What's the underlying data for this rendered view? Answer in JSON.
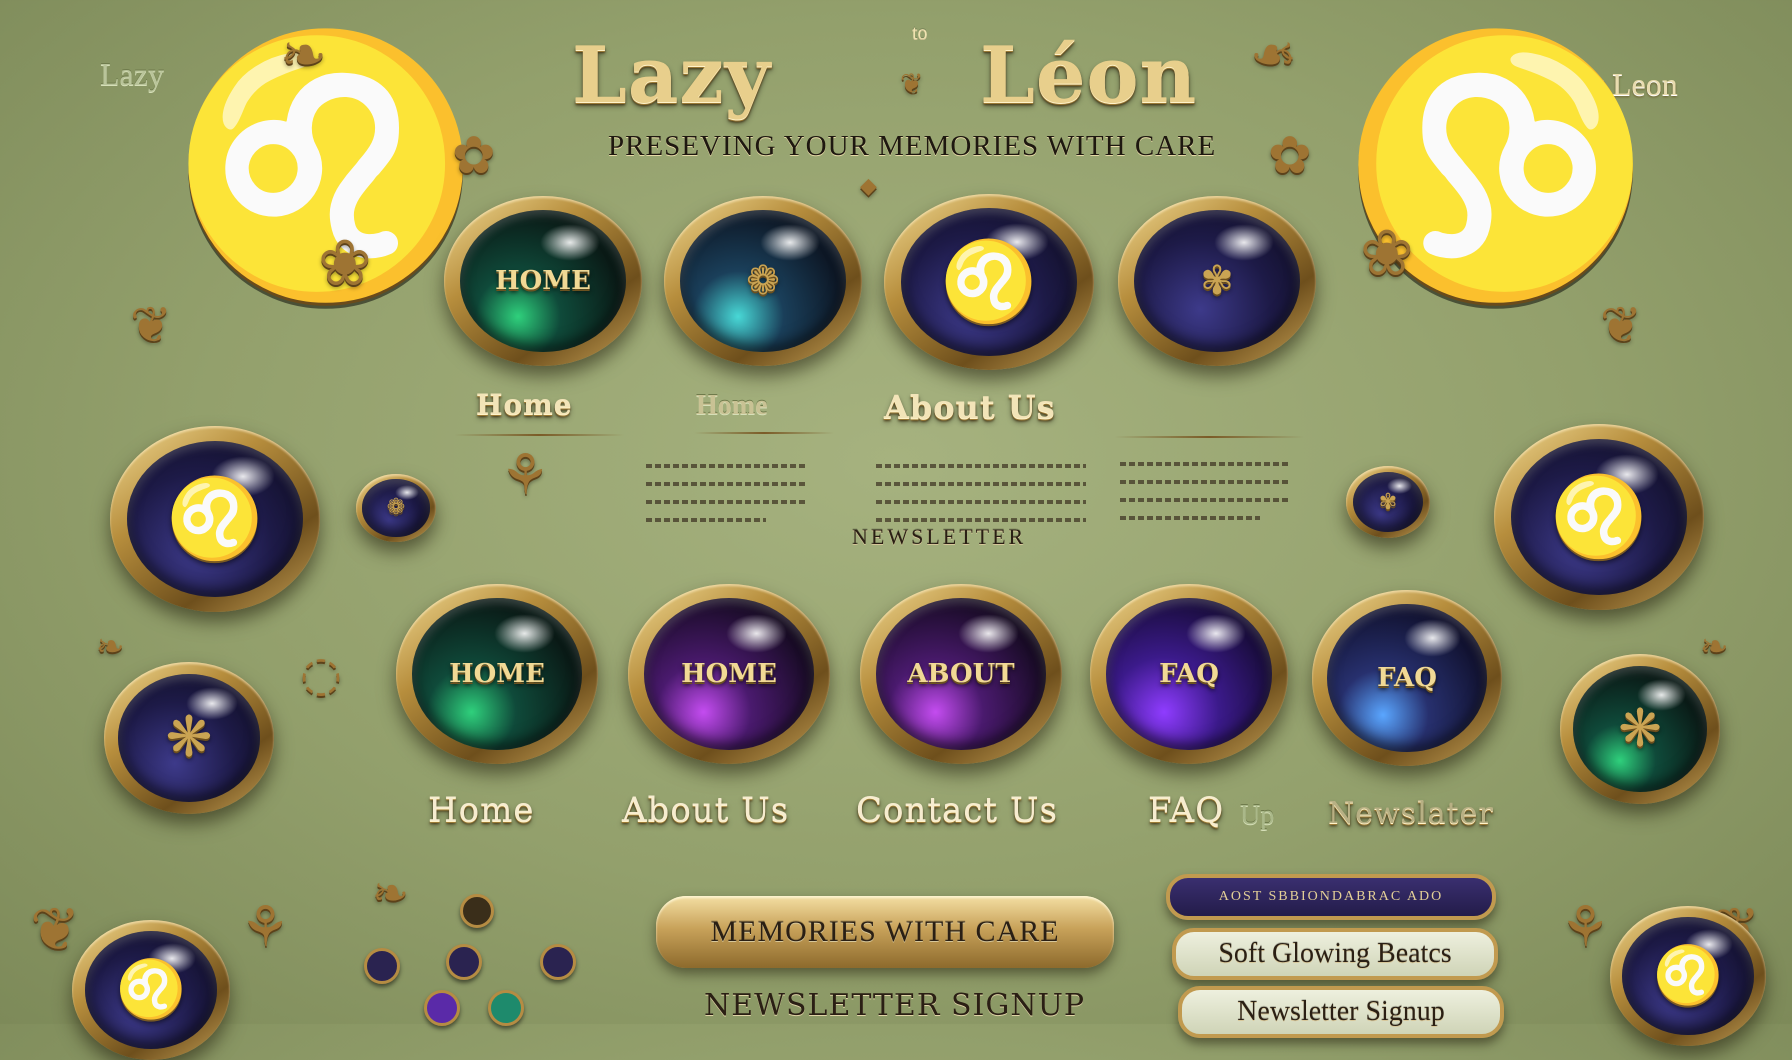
{
  "header": {
    "title_left": "Lazy",
    "title_connector": "to",
    "title_right": "Léon",
    "tagline": "Preseving your memories with care",
    "corner_left": "Lazy",
    "corner_right": "Lazy Leon"
  },
  "top_buttons": [
    {
      "label": "HOME",
      "core": "green"
    },
    {
      "label": "",
      "core": "teal"
    },
    {
      "label": "",
      "core": "navy",
      "icon": "lion-face-icon"
    },
    {
      "label": "",
      "core": "navy",
      "icon": "emblem-icon"
    }
  ],
  "top_nav": {
    "items": [
      "Home",
      "Home",
      "About Us"
    ],
    "newsletter_label": "Newsletter"
  },
  "bottom_buttons": [
    {
      "label": "HOME",
      "core": "green"
    },
    {
      "label": "HOME",
      "core": "purple"
    },
    {
      "label": "ABOUT",
      "core": "purple"
    },
    {
      "label": "FAQ",
      "core": "violet"
    },
    {
      "label": "FAQ",
      "core": "blue"
    }
  ],
  "bottom_nav": {
    "items": [
      "Home",
      "About Us",
      "Contact Us",
      "FAQ",
      "Newslater"
    ],
    "faq_suffix": "Up"
  },
  "plaques": {
    "memories": "Memories with Care",
    "newsletter_signup_left": "Newsletter Signup",
    "dark_plaque": "Aost Sbbiondabrac Ado",
    "soft_glowing": "Soft Glowing Beatcs",
    "newsletter_signup_right": "Newsletter Signup"
  },
  "icons": {
    "lion": "lion-icon",
    "flower": "flower-icon",
    "emblem": "emblem-icon"
  },
  "colors": {
    "background": "#9aa774",
    "gold": "#c8a25a",
    "purple": "#6b2fd0",
    "green": "#2fd07c"
  }
}
